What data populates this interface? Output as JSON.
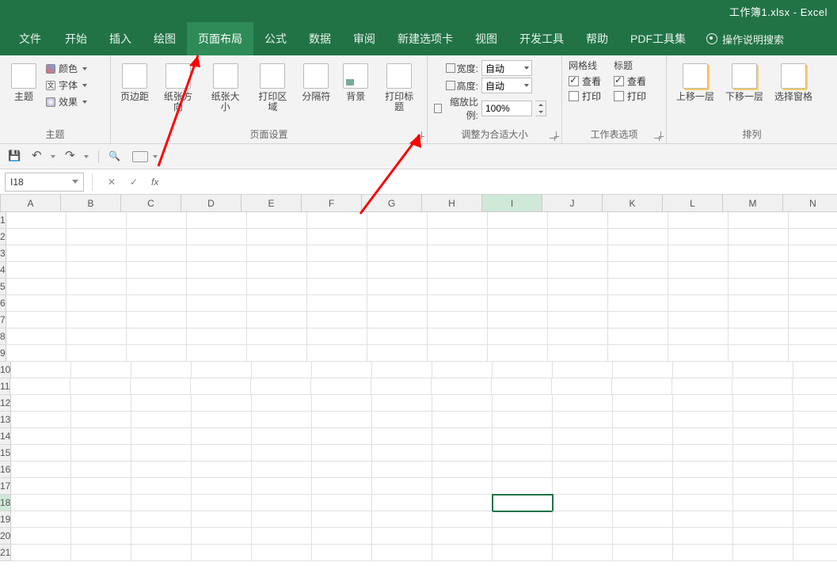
{
  "title": "工作簿1.xlsx - Excel",
  "tabs": {
    "file": "文件",
    "home": "开始",
    "insert": "插入",
    "draw": "绘图",
    "pagelayout": "页面布局",
    "formulas": "公式",
    "data": "数据",
    "review": "审阅",
    "newtab": "新建选项卡",
    "view": "视图",
    "developer": "开发工具",
    "help": "帮助",
    "pdf": "PDF工具集"
  },
  "tellme": "操作说明搜索",
  "ribbon": {
    "theme": {
      "colors": "颜色",
      "fonts": "字体",
      "effects": "效果",
      "main": "主题",
      "group": "主题"
    },
    "pagesetup": {
      "margins": "页边距",
      "orientation": "纸张方向",
      "size": "纸张大小",
      "printarea": "打印区域",
      "breaks": "分隔符",
      "background": "背景",
      "printtitles": "打印标题",
      "group": "页面设置"
    },
    "scale": {
      "width_label": "宽度:",
      "height_label": "高度:",
      "scale_label": "缩放比例:",
      "width_val": "自动",
      "height_val": "自动",
      "scale_val": "100%",
      "group": "调整为合适大小"
    },
    "sheetopts": {
      "grid_hdr": "网格线",
      "headings_hdr": "标题",
      "view": "查看",
      "print": "打印",
      "group": "工作表选项",
      "grid_view_checked": true,
      "grid_print_checked": false,
      "head_view_checked": true,
      "head_print_checked": false
    },
    "arrange": {
      "forward": "上移一层",
      "backward": "下移一层",
      "selection": "选择窗格",
      "group": "排列"
    }
  },
  "namebox": "I18",
  "columns": [
    "A",
    "B",
    "C",
    "D",
    "E",
    "F",
    "G",
    "H",
    "I",
    "J",
    "K",
    "L",
    "M",
    "N"
  ],
  "rows": [
    1,
    2,
    3,
    4,
    5,
    6,
    7,
    8,
    9,
    10,
    11,
    12,
    13,
    14,
    15,
    16,
    17,
    18,
    19,
    20,
    21
  ],
  "active_col": "I",
  "active_row": 18
}
